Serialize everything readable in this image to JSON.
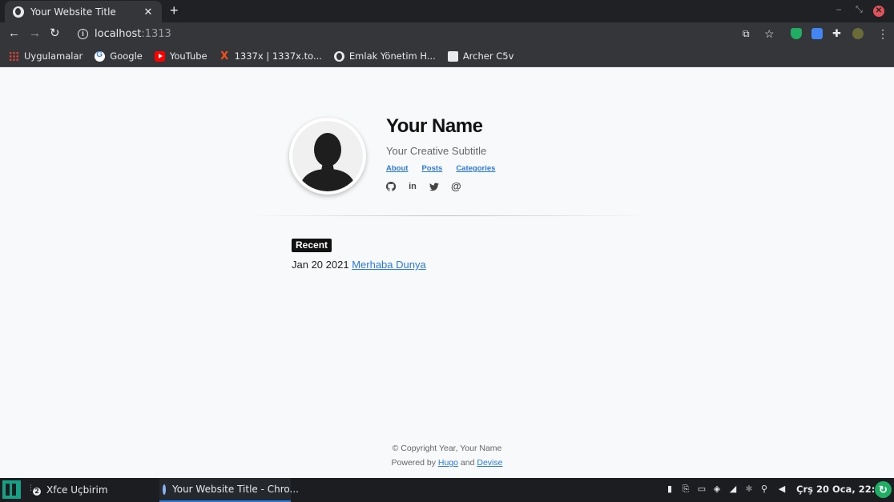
{
  "browser": {
    "tab_title": "Your Website Title",
    "tab_close": "✕",
    "new_tab": "+",
    "url_host": "localhost",
    "url_port": ":1313"
  },
  "bookmarks": [
    {
      "label": "Uygulamalar",
      "icon": "apps-grid-icon"
    },
    {
      "label": "Google",
      "icon": "google-icon"
    },
    {
      "label": "YouTube",
      "icon": "youtube-icon"
    },
    {
      "label": "1337x | 1337x.to...",
      "icon": "x-icon"
    },
    {
      "label": "Emlak Yönetim H...",
      "icon": "globe-icon"
    },
    {
      "label": "Archer C5v",
      "icon": "archer-icon"
    }
  ],
  "site": {
    "name": "Your Name",
    "subtitle": "Your Creative Subtitle",
    "nav": [
      "About",
      "Posts",
      "Categories"
    ],
    "socials": [
      "github-icon",
      "linkedin-icon",
      "twitter-icon",
      "email-icon"
    ]
  },
  "recent": {
    "heading": "Recent",
    "posts": [
      {
        "date": "Jan 20 2021",
        "title": "Merhaba Dunya"
      }
    ]
  },
  "footer": {
    "copyright": "© Copyright Year, Your Name",
    "powered_prefix": "Powered by",
    "hugo": "Hugo",
    "and": "and",
    "theme": "Devise"
  },
  "taskbar": {
    "terminal_badge": "2",
    "terminal": "Xfce Uçbirim",
    "browser": "Your Website Title - Chro...",
    "clock": "Çrş 20 Oca, 22:28"
  }
}
